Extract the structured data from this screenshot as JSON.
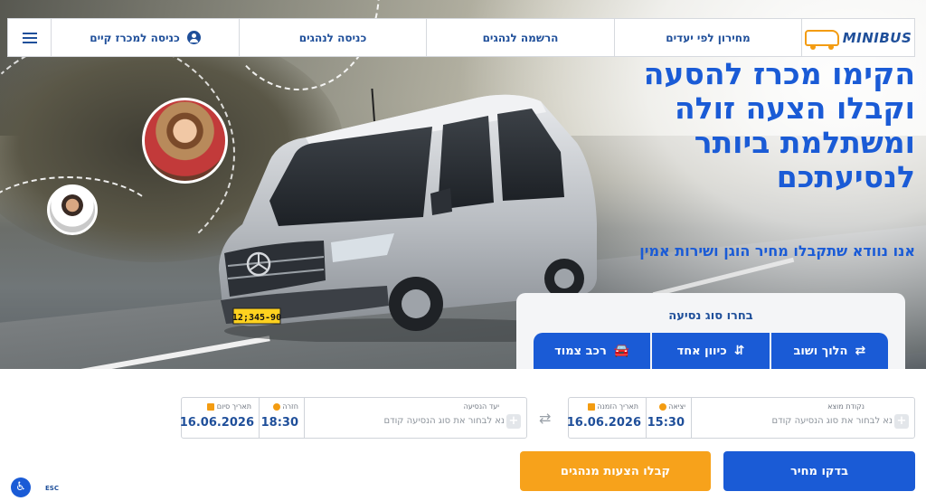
{
  "nav": {
    "logo": "MINIBUS",
    "price_by_destination": "מחירון לפי יעדים",
    "driver_registration": "הרשמה לנהגים",
    "driver_login": "כניסה לנהגים",
    "existing_tender_login": "כניסה למכרז קיים"
  },
  "hero": {
    "headline": [
      "הקימו מכרז להסעה",
      "וקבלו הצעה זולה",
      "ומשתלמת ביותר",
      "לנסיעתכם"
    ],
    "subline": "אנו נוודא שתקבלו מחיר הוגן ושירות אמין",
    "plate": "12;345-90"
  },
  "trip_type": {
    "title": "בחרו סוג נסיעה",
    "options": [
      {
        "label": "רכב צמוד",
        "icon": "car-icon"
      },
      {
        "label": "כיוון אחד",
        "icon": "route-icon"
      },
      {
        "label": "הלוך ושוב",
        "icon": "bus-roundtrip-icon"
      }
    ]
  },
  "form": {
    "origin_label": "נקודת מוצא",
    "origin_placeholder": "נא לבחור את סוג הנסיעה קודם",
    "departure_label": "יציאה",
    "departure_value": "15:30",
    "order_date_label": "תאריך הזמנה",
    "order_date_value": "16.06.2026",
    "destination_label": "יעד הנסיעה",
    "destination_placeholder": "נא לבחור את סוג הנסיעה קודם",
    "return_label": "חזרה",
    "return_value": "18:30",
    "end_date_label": "תאריך סיום",
    "end_date_value": "16.06.2026",
    "check_price": "בדקו מחיר",
    "get_offers": "קבלו הצעות מנהגים"
  },
  "accessibility": {
    "esc": "ESC"
  },
  "colors": {
    "primary": "#1a5bd6",
    "accent": "#f7a21b",
    "navy": "#1f4f9a"
  }
}
